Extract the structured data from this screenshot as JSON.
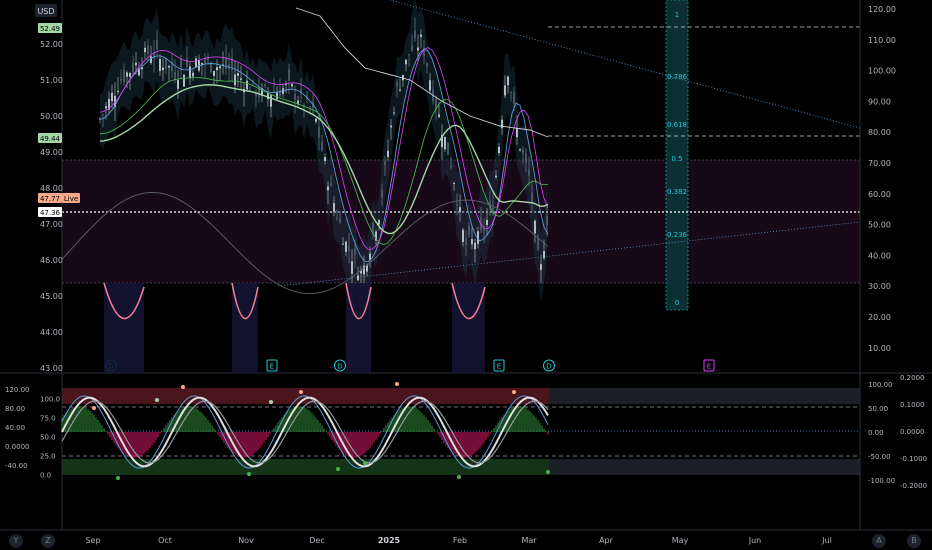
{
  "chart_data": {
    "type": "candlestick",
    "currency_label": "USD",
    "x_labels": [
      "Sep",
      "Oct",
      "Nov",
      "Dec",
      "2025",
      "Feb",
      "Mar",
      "Apr",
      "May",
      "Jun",
      "Jul"
    ],
    "price_axis": {
      "left_ticks": [
        "52.00",
        "51.00",
        "50.00",
        "49.00",
        "48.00",
        "47.00",
        "46.00",
        "45.00",
        "44.00",
        "43.00"
      ],
      "right_ticks": [
        "120.00",
        "110.00",
        "100.00",
        "90.00",
        "80.00",
        "70.00",
        "60.00",
        "50.00",
        "40.00",
        "30.00",
        "20.00",
        "10.00"
      ],
      "badges": [
        {
          "text": "52.49",
          "color": "#a5d6a7"
        },
        {
          "text": "49.44",
          "color": "#a5d6a7"
        },
        {
          "text": "47.77",
          "color": "#f7a78a"
        },
        {
          "text": "Live",
          "color": "#f7a78a"
        },
        {
          "text": "47.36",
          "color": "#ffffff"
        }
      ],
      "last_price": 47.36
    },
    "fibonacci": {
      "levels": [
        "1",
        "0.786",
        "0.618",
        "0.5",
        "0.382",
        "0.236",
        "0"
      ],
      "color": "#26c6da"
    },
    "event_markers": [
      "D",
      "E",
      "D",
      "E",
      "D",
      "E"
    ],
    "oscillator": {
      "left_ticks": [
        "120.00",
        "100.0",
        "80.00",
        "75.0",
        "40.00",
        "50.0",
        "0.0000",
        "25.0",
        "-40.00",
        "0.0"
      ],
      "right_ticks": [
        "100.00",
        "50.00",
        "0.00",
        "-50.00",
        "-100.00"
      ],
      "right_ticks_2": [
        "0.2000",
        "0.1000",
        "0.0000",
        "-0.1000",
        "-0.2000"
      ],
      "overbought_color": "#b71c3c",
      "oversold_color": "#1b5e20"
    },
    "bottom_icons": [
      "Y",
      "Z",
      "A",
      "B"
    ]
  }
}
